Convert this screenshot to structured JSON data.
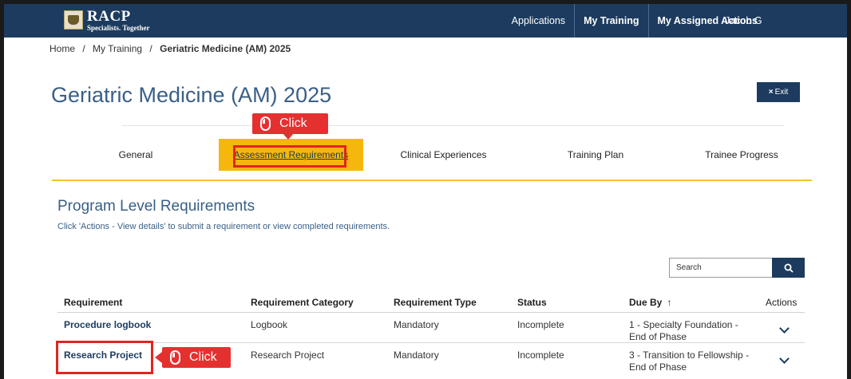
{
  "navbar": {
    "logo_main": "RACP",
    "logo_sub": "Specialists. Together",
    "items": [
      {
        "label": "Applications"
      },
      {
        "label": "My Training"
      },
      {
        "label": "My Assigned Actions"
      }
    ],
    "user": "Jacob G"
  },
  "breadcrumb": {
    "home": "Home",
    "sep": "/",
    "parent": "My Training",
    "current": "Geriatric Medicine (AM) 2025"
  },
  "page": {
    "title": "Geriatric Medicine (AM) 2025",
    "exit_icon": "×",
    "exit_label": "Exit"
  },
  "callouts": {
    "label": "Click",
    "icon": "mouse-icon",
    "color": "#e53030"
  },
  "tabs": [
    {
      "label": "General",
      "active": false
    },
    {
      "label": "Assessment Requirements",
      "active": true
    },
    {
      "label": "Clinical Experiences",
      "active": false
    },
    {
      "label": "Training Plan",
      "active": false
    },
    {
      "label": "Trainee Progress",
      "active": false
    }
  ],
  "section": {
    "title": "Program Level Requirements",
    "subtitle": "Click 'Actions - View details' to submit a requirement or view completed requirements."
  },
  "search": {
    "value": "Search",
    "icon": "search-icon"
  },
  "table": {
    "columns": [
      "Requirement",
      "Requirement Category",
      "Requirement Type",
      "Status",
      "Due By",
      "Actions"
    ],
    "sort_indicator": "↑",
    "rows": [
      {
        "requirement": "Procedure logbook",
        "category": "Logbook",
        "type": "Mandatory",
        "status": "Incomplete",
        "due_line1": "1 - Specialty Foundation -",
        "due_line2": "End of Phase"
      },
      {
        "requirement": "Research Project",
        "category": "Research Project",
        "type": "Mandatory",
        "status": "Incomplete",
        "due_line1": "3 - Transition to Fellowship -",
        "due_line2": "End of Phase"
      }
    ]
  },
  "colors": {
    "navbar": "#1c3b5e",
    "accent": "#f5b70c",
    "title": "#3a5f86",
    "highlight": "#e0251f"
  }
}
